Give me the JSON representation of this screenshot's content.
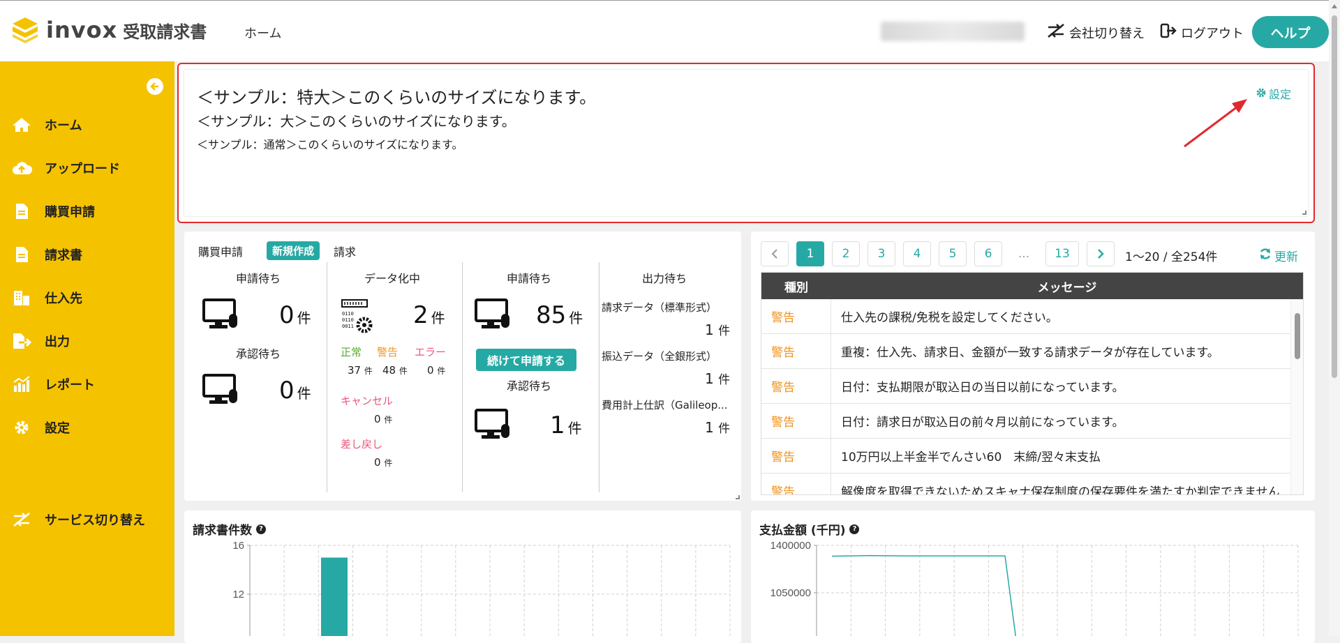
{
  "header": {
    "brand": "invox",
    "brand_sub": "受取請求書",
    "home": "ホーム",
    "company_switch": "会社切り替え",
    "logout": "ログアウト",
    "help": "ヘルプ"
  },
  "sidebar": {
    "items": [
      {
        "label": "ホーム",
        "icon": "home-icon"
      },
      {
        "label": "アップロード",
        "icon": "cloud-upload-icon"
      },
      {
        "label": "購買申請",
        "icon": "document-icon"
      },
      {
        "label": "請求書",
        "icon": "document-icon"
      },
      {
        "label": "仕入先",
        "icon": "building-icon"
      },
      {
        "label": "出力",
        "icon": "export-icon"
      },
      {
        "label": "レポート",
        "icon": "chart-icon"
      },
      {
        "label": "設定",
        "icon": "gear-icon"
      },
      {
        "label": "サービス切り替え",
        "icon": "switch-icon"
      }
    ]
  },
  "notice": {
    "line_xl": "＜サンプル：特大＞このくらいのサイズになります。",
    "line_l": "＜サンプル：大＞このくらいのサイズになります。",
    "line_n": "＜サンプル：通常＞このくらいのサイズになります。",
    "settings": "設定"
  },
  "summary": {
    "purchase_title": "購買申請",
    "new_button": "新規作成",
    "invoice_title": "請求",
    "unit": "件",
    "purchase": {
      "pending_label": "申請待ち",
      "pending_count": "0",
      "approval_label": "承認待ち",
      "approval_count": "0"
    },
    "digitizing": {
      "label": "データ化中",
      "count": "2",
      "normal_label": "正常",
      "warning_label": "警告",
      "error_label": "エラー",
      "normal_count": "37",
      "warning_count": "48",
      "error_count": "0",
      "cancel_label": "キャンセル",
      "cancel_count": "0",
      "return_label": "差し戻し",
      "return_count": "0"
    },
    "invoice_pending": {
      "label": "申請待ち",
      "count": "85",
      "continue_button": "続けて申請する",
      "approval_label": "承認待ち",
      "approval_count": "1"
    },
    "output": {
      "label": "出力待ち",
      "items": [
        {
          "name": "請求データ（標準形式）",
          "count": "1"
        },
        {
          "name": "振込データ（全銀形式）",
          "count": "1"
        },
        {
          "name": "費用計上仕訳（Galileop...",
          "count": "1"
        }
      ]
    }
  },
  "messages": {
    "pages": [
      "1",
      "2",
      "3",
      "4",
      "5",
      "6",
      "...",
      "13"
    ],
    "active_page": "1",
    "range": "1〜20 / 全254件",
    "refresh": "更新",
    "col_type": "種別",
    "col_message": "メッセージ",
    "rows": [
      {
        "type": "警告",
        "message": "仕入先の課税/免税を設定してください。"
      },
      {
        "type": "警告",
        "message": "重複：仕入先、請求日、金額が一致する請求データが存在しています。"
      },
      {
        "type": "警告",
        "message": "日付：支払期限が取込日の当日以前になっています。"
      },
      {
        "type": "警告",
        "message": "日付：請求日が取込日の前々月以前になっています。"
      },
      {
        "type": "警告",
        "message": "10万円以上半金半でんさい60　末締/翌々末支払"
      },
      {
        "type": "警告",
        "message": "解像度を取得できないためスキャナ保存制度の保存要件を満たすか判定できません"
      }
    ]
  },
  "charts": {
    "invoice_count_title": "請求書件数",
    "payment_title": "支払金額 (千円)"
  },
  "chart_data": [
    {
      "type": "bar",
      "title": "請求書件数",
      "y_ticks": [
        "16",
        "12"
      ],
      "ylim": [
        0,
        16
      ],
      "values": [
        15,
        0.5
      ],
      "color": "#26a9a4"
    },
    {
      "type": "line",
      "title": "支払金額 (千円)",
      "y_ticks": [
        "1400000",
        "1050000"
      ],
      "values": [
        1320000,
        1325000,
        1322000,
        1322000,
        1322000,
        700000
      ],
      "color": "#26a9a4"
    }
  ],
  "colors": {
    "accent": "#26a9a4",
    "sidebar": "#f5c200",
    "warning": "#f0931e",
    "error": "#e8577a",
    "highlight": "#e0292f"
  }
}
